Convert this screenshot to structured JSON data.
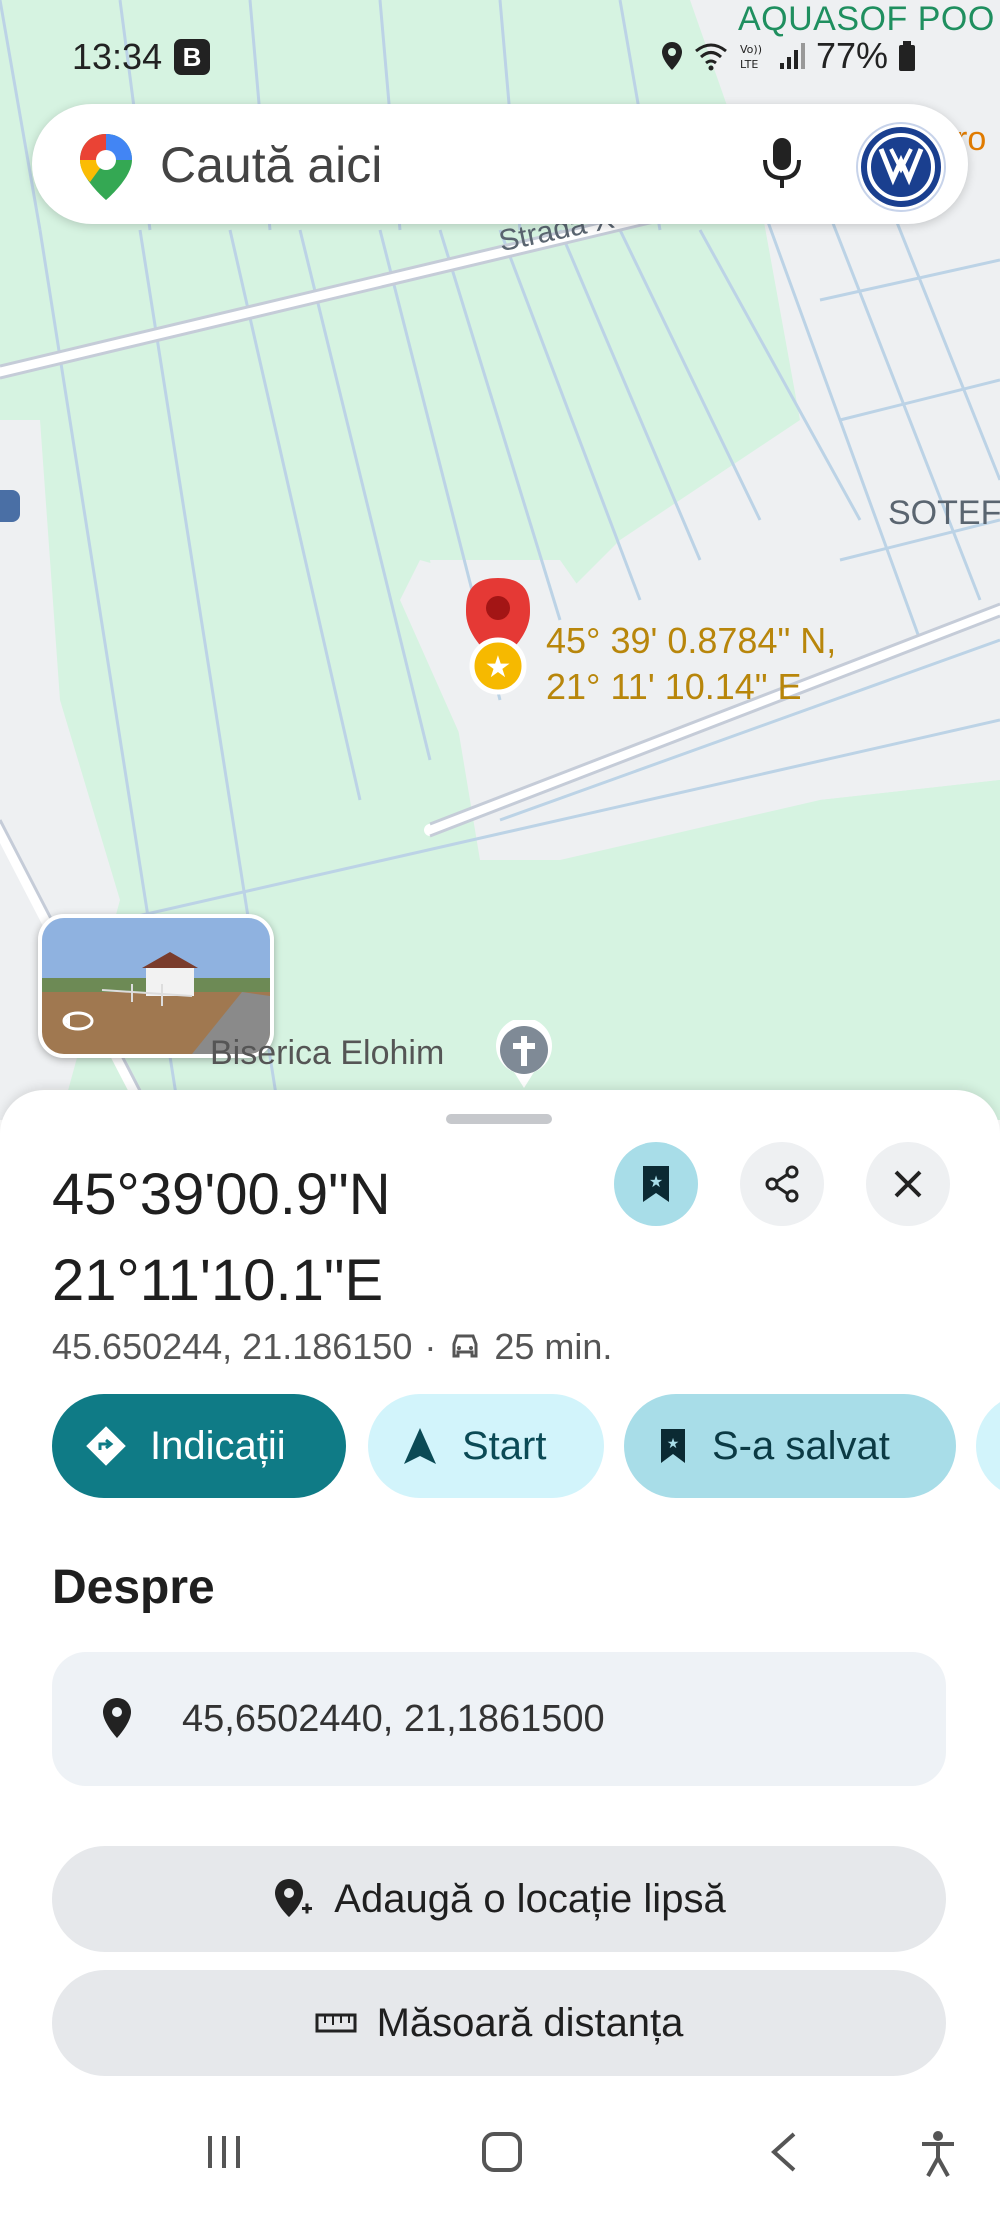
{
  "status_bar": {
    "time": "13:34",
    "notification_badge": "B",
    "battery": "77%",
    "icons": [
      "location-icon",
      "wifi-icon",
      "volte-icon",
      "signal-icon",
      "battery-icon"
    ]
  },
  "search": {
    "placeholder": "Caută aici"
  },
  "map": {
    "labels": {
      "top_right_business": "AQUASOF POO",
      "top_right_partial": "ro",
      "street": "Strada X",
      "area": "SOTEF",
      "church": "Biserica Elohim"
    },
    "pin_coordinates": {
      "lat": "45° 39' 0.8784\" N,",
      "lng": "21° 11' 10.14\" E"
    },
    "colors": {
      "park": "#c9efd7",
      "land": "#eef0f2",
      "road": "#c5ccd8",
      "pin": "#e53935",
      "star": "#f6b900"
    }
  },
  "place": {
    "title_line1": "45°39'00.9\"N",
    "title_line2": "21°11'10.1\"E",
    "decimal_coords": "45.650244, 21.186150",
    "separator": "·",
    "drive_time": "25 min."
  },
  "actions": {
    "directions": "Indicații",
    "start": "Start",
    "saved": "S-a salvat"
  },
  "about": {
    "heading": "Despre",
    "coordinates": "45,6502440, 21,1861500",
    "add_missing_place": "Adaugă o locație lipsă",
    "measure_distance": "Măsoară distanța"
  },
  "accent_colors": {
    "primary": "#0f7b86",
    "chip_light": "#d2f4fb",
    "chip_saved": "#a8dde8"
  }
}
